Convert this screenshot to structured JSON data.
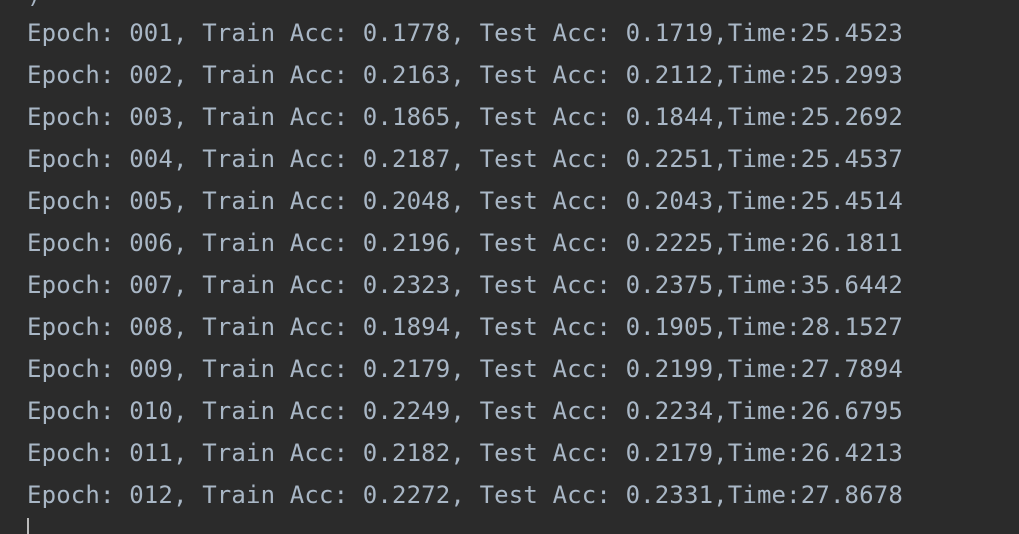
{
  "console": {
    "previous_line": ")",
    "lines": [
      "Epoch: 001, Train Acc: 0.1778, Test Acc: 0.1719,Time:25.4523",
      "Epoch: 002, Train Acc: 0.2163, Test Acc: 0.2112,Time:25.2993",
      "Epoch: 003, Train Acc: 0.1865, Test Acc: 0.1844,Time:25.2692",
      "Epoch: 004, Train Acc: 0.2187, Test Acc: 0.2251,Time:25.4537",
      "Epoch: 005, Train Acc: 0.2048, Test Acc: 0.2043,Time:25.4514",
      "Epoch: 006, Train Acc: 0.2196, Test Acc: 0.2225,Time:26.1811",
      "Epoch: 007, Train Acc: 0.2323, Test Acc: 0.2375,Time:35.6442",
      "Epoch: 008, Train Acc: 0.1894, Test Acc: 0.1905,Time:28.1527",
      "Epoch: 009, Train Acc: 0.2179, Test Acc: 0.2199,Time:27.7894",
      "Epoch: 010, Train Acc: 0.2249, Test Acc: 0.2234,Time:26.6795",
      "Epoch: 011, Train Acc: 0.2182, Test Acc: 0.2179,Time:26.4213",
      "Epoch: 012, Train Acc: 0.2272, Test Acc: 0.2331,Time:27.8678"
    ],
    "colors": {
      "background": "#2b2b2b",
      "text": "#a9b7c6",
      "cursor": "#bbbbbb"
    }
  }
}
